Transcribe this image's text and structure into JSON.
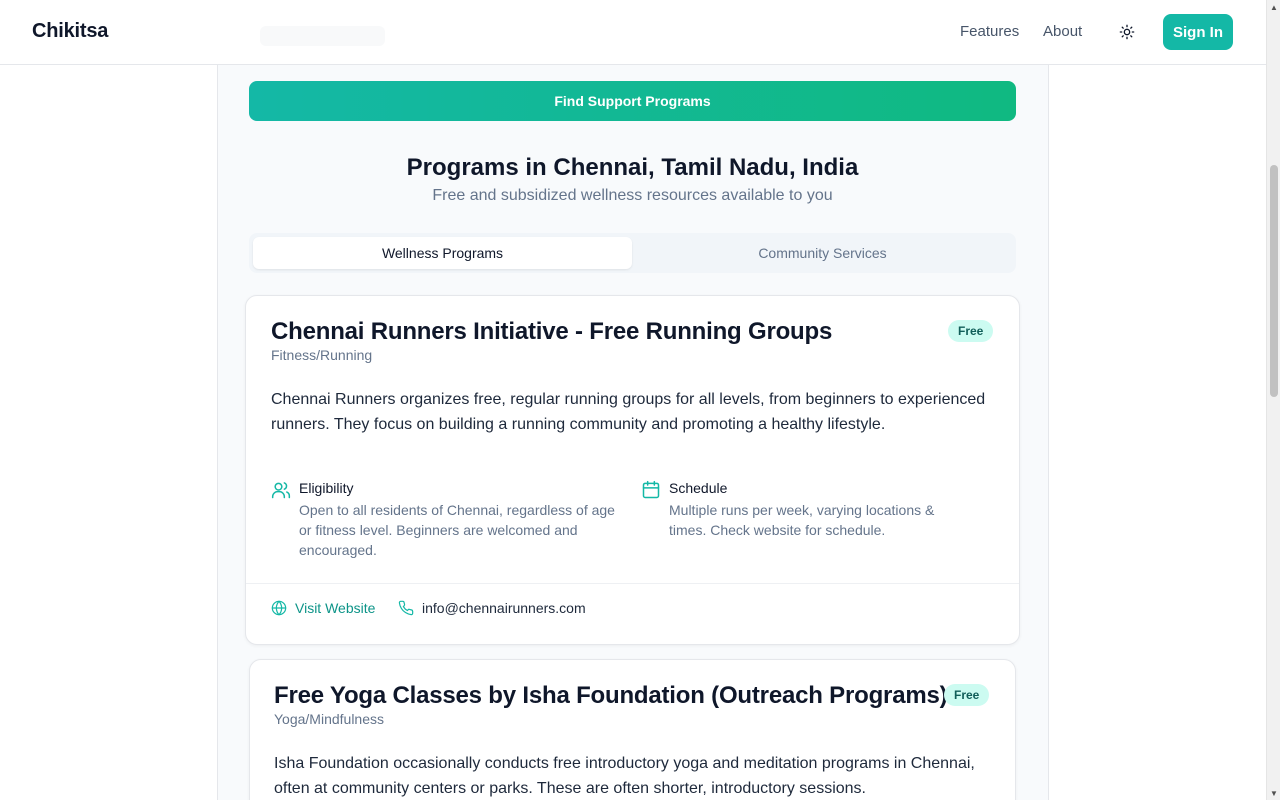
{
  "header": {
    "brand": "Chikitsa",
    "nav": {
      "features": "Features",
      "about": "About"
    },
    "theme_icon": "sun-icon",
    "sign_in": "Sign In"
  },
  "search": {
    "find_button": "Find Support Programs"
  },
  "results": {
    "title": "Programs in Chennai, Tamil Nadu, India",
    "subtitle": "Free and subsidized wellness resources available to you",
    "tabs": [
      {
        "label": "Wellness Programs",
        "active": true
      },
      {
        "label": "Community Services",
        "active": false
      }
    ]
  },
  "programs": [
    {
      "title": "Chennai Runners Initiative - Free Running Groups",
      "category": "Fitness/Running",
      "badge": "Free",
      "description": "Chennai Runners organizes free, regular running groups for all levels, from beginners to experienced runners. They focus on building a running community and promoting a healthy lifestyle.",
      "eligibility_label": "Eligibility",
      "eligibility": "Open to all residents of Chennai, regardless of age or fitness level. Beginners are welcomed and encouraged.",
      "schedule_label": "Schedule",
      "schedule": "Multiple runs per week, varying locations & times. Check website for schedule.",
      "website_label": "Visit Website",
      "contact": "info@chennairunners.com"
    },
    {
      "title": "Free Yoga Classes by Isha Foundation (Outreach Programs)",
      "category": "Yoga/Mindfulness",
      "badge": "Free",
      "description": "Isha Foundation occasionally conducts free introductory yoga and meditation programs in Chennai, often at community centers or parks. These are often shorter, introductory sessions."
    }
  ],
  "colors": {
    "accent": "#14b8a6",
    "accent_gradient_end": "#10b981",
    "badge_bg": "#ccfbf1",
    "badge_text": "#115e59"
  }
}
